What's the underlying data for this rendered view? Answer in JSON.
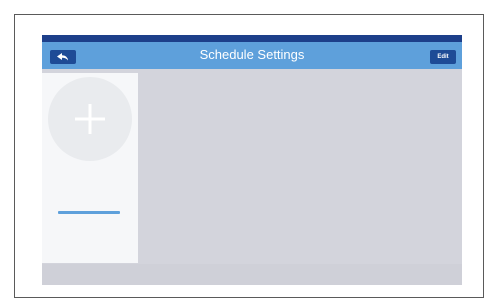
{
  "header": {
    "title": "Schedule Settings",
    "back_icon": "back-arrow-icon",
    "edit_label": "Edit"
  },
  "schedule_panel": {
    "add_icon": "plus-icon"
  },
  "colors": {
    "top_strip": "#1d3f8a",
    "header_bar": "#5ea0db",
    "button": "#1e4b96",
    "screen_background": "#d3d4dc",
    "panel_background": "#f6f7f9",
    "accent": "#5ea0db"
  }
}
